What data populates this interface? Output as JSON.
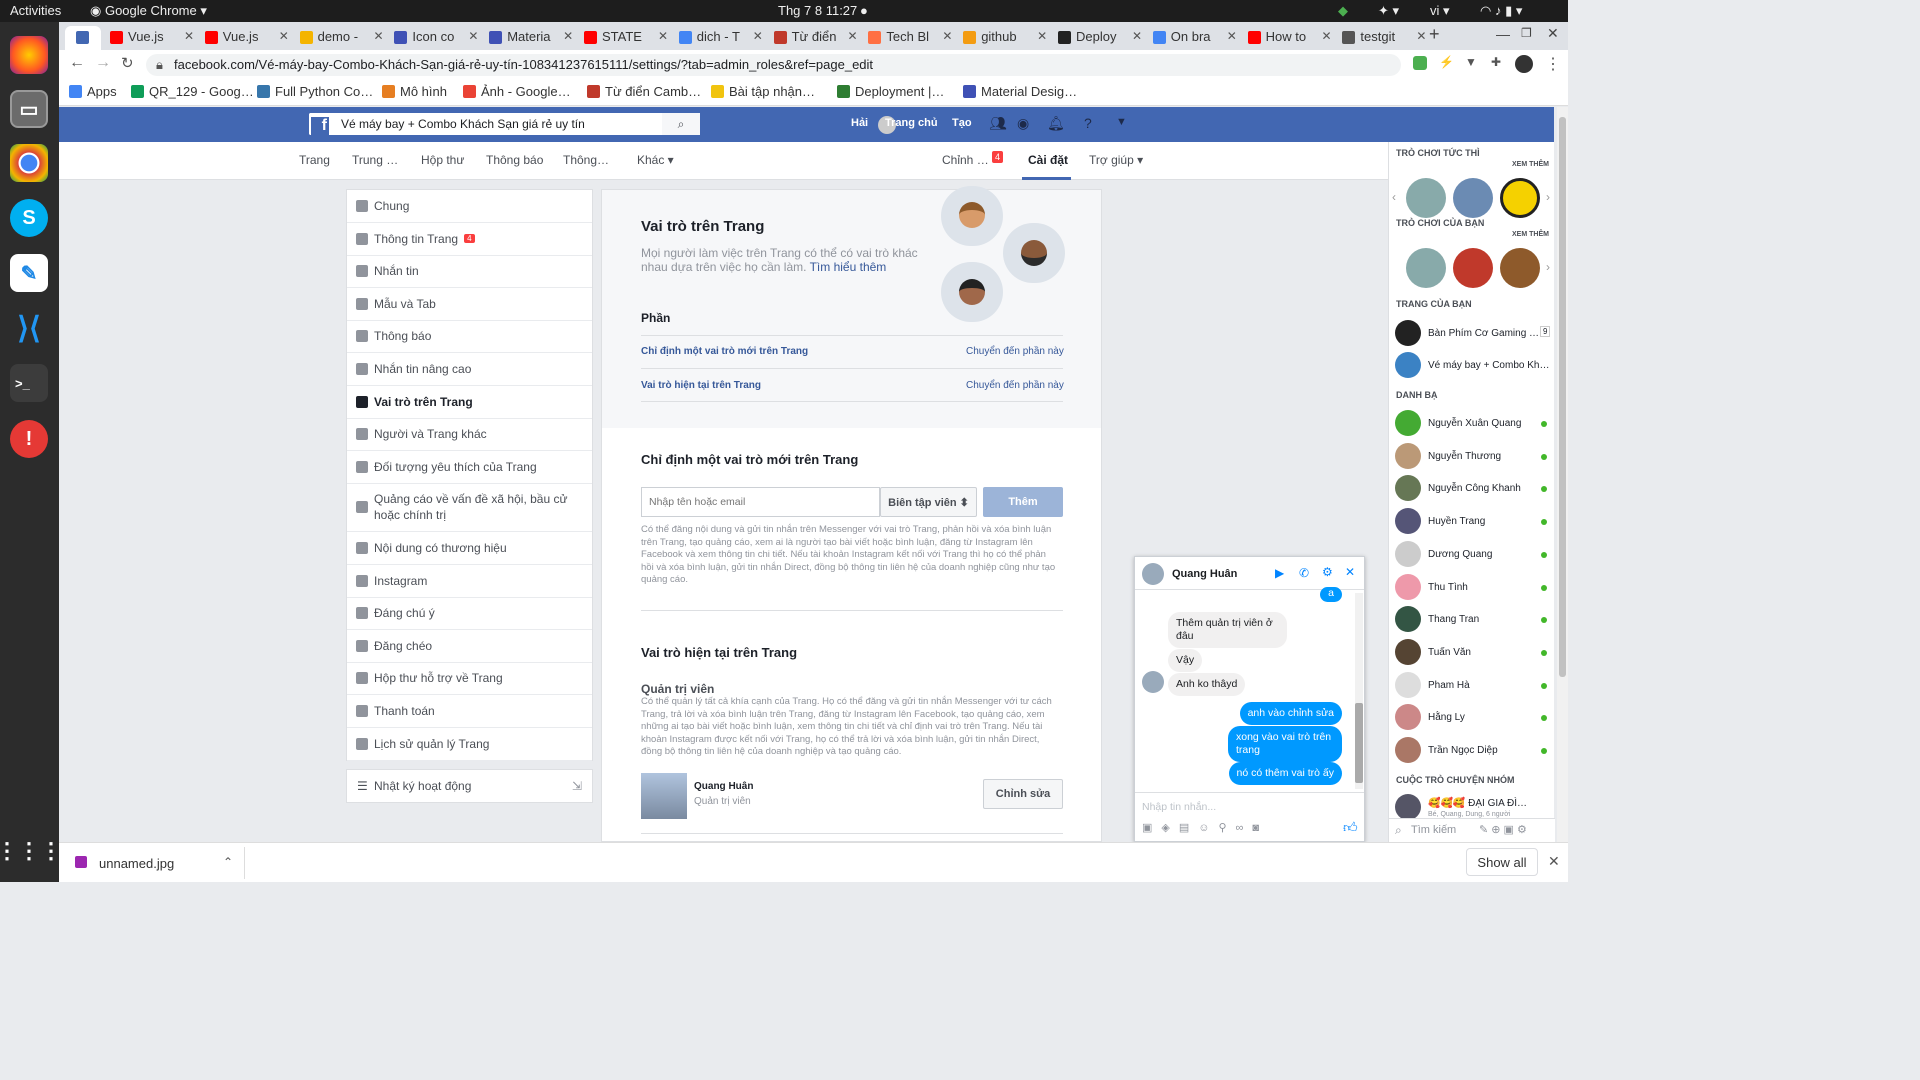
{
  "system_bar": {
    "activities": "Activities",
    "app": "Google Chrome",
    "clock": "Thg 7 8  11:27",
    "lang": "vi"
  },
  "tabs": [
    {
      "label": "Vue.js",
      "color": "#ff0000"
    },
    {
      "label": "Vue.js",
      "color": "#ff0000"
    },
    {
      "label": "demo -",
      "color": "#f4b400"
    },
    {
      "label": "Icon co",
      "color": "#3f51b5"
    },
    {
      "label": "Materia",
      "color": "#3f51b5"
    },
    {
      "label": "STATE",
      "color": "#ff0000"
    },
    {
      "label": "dich - T",
      "color": "#4285f4"
    },
    {
      "label": "Từ điển",
      "color": "#c0392b"
    },
    {
      "label": "Tech Bl",
      "color": "#ff7043"
    },
    {
      "label": "github",
      "color": "#f39c12"
    },
    {
      "label": "Deploy",
      "color": "#222222"
    },
    {
      "label": "On bra",
      "color": "#4285f4"
    },
    {
      "label": "How to",
      "color": "#ff0000"
    },
    {
      "label": "testgit",
      "color": "#555555"
    }
  ],
  "address": {
    "url": "facebook.com/Vé-máy-bay-Combo-Khách-Sạn-giá-rẻ-uy-tín-108341237615111/settings/?tab=admin_roles&ref=page_edit"
  },
  "bookmarks": [
    {
      "label": "Apps",
      "color": "#4285f4"
    },
    {
      "label": "QR_129 - Goog…",
      "color": "#0f9d58"
    },
    {
      "label": "Full Python Co…",
      "color": "#3776ab"
    },
    {
      "label": "Mô hình",
      "color": "#e67e22"
    },
    {
      "label": "Ảnh - Google…",
      "color": "#ea4335"
    },
    {
      "label": "Từ điển Camb…",
      "color": "#c0392b"
    },
    {
      "label": "Bài tập nhận…",
      "color": "#f1c40f"
    },
    {
      "label": "Deployment |…",
      "color": "#2e7d32"
    },
    {
      "label": "Material Desig…",
      "color": "#3f51b5"
    }
  ],
  "fb_header": {
    "search_value": "Vé máy bay + Combo Khách Sạn giá rẻ uy tín",
    "user": "Hải",
    "home": "Trang chủ",
    "create": "Tạo"
  },
  "page_nav": {
    "left": [
      "Trang",
      "Trung …",
      "Hộp thư",
      "Thông báo",
      "Thông…",
      "Khác ▾"
    ],
    "edit": "Chỉnh …",
    "edit_badge": "4",
    "settings": "Cài đặt",
    "help": "Trợ giúp ▾"
  },
  "settings_menu": [
    {
      "label": "Chung"
    },
    {
      "label": "Thông tin Trang",
      "badge": "4"
    },
    {
      "label": "Nhắn tin"
    },
    {
      "label": "Mẫu và Tab"
    },
    {
      "label": "Thông báo"
    },
    {
      "label": "Nhắn tin nâng cao"
    },
    {
      "label": "Vai trò trên Trang",
      "active": true
    },
    {
      "label": "Người và Trang khác"
    },
    {
      "label": "Đối tượng yêu thích của Trang"
    },
    {
      "label": "Quảng cáo về vấn đề xã hội, bầu cử hoặc chính trị"
    },
    {
      "label": "Nội dung có thương hiệu"
    },
    {
      "label": "Instagram"
    },
    {
      "label": "Đáng chú ý"
    },
    {
      "label": "Đăng chéo"
    },
    {
      "label": "Hộp thư hỗ trợ về Trang"
    },
    {
      "label": "Thanh toán"
    },
    {
      "label": "Lịch sử quản lý Trang"
    }
  ],
  "activity_log": "Nhật ký hoạt động",
  "roles": {
    "title": "Vai trò trên Trang",
    "desc": "Mọi người làm việc trên Trang có thể có vai trò khác nhau dựa trên việc họ cần làm.",
    "learn_more": "Tìm hiểu thêm",
    "section_label": "Phần",
    "section_rows": [
      {
        "name": "Chỉ định một vai trò mới trên Trang",
        "action": "Chuyển đến phần này"
      },
      {
        "name": "Vai trò hiện tại trên Trang",
        "action": "Chuyển đến phần này"
      }
    ],
    "assign_title": "Chỉ định một vai trò mới trên Trang",
    "assign_placeholder": "Nhập tên hoặc email",
    "assign_role": "Biên tập viên ⬍",
    "assign_button": "Thêm",
    "assign_desc": "Có thể đăng nội dung và gửi tin nhắn trên Messenger với vai trò Trang, phản hồi và xóa bình luận trên Trang, tạo quảng cáo, xem ai là người tạo bài viết hoặc bình luận, đăng từ Instagram lên Facebook và xem thông tin chi tiết. Nếu tài khoản Instagram kết nối với Trang thì họ có thể phản hồi và xóa bình luận, gửi tin nhắn Direct, đồng bộ thông tin liên hệ của doanh nghiệp cũng như tạo quảng cáo.",
    "current_title": "Vai trò hiện tại trên Trang",
    "admin_label": "Quản trị viên",
    "admin_desc": "Có thể quản lý tất cả khía cạnh của Trang. Họ có thể đăng và gửi tin nhắn Messenger với tư cách Trang, trả lời và xóa bình luận trên Trang, đăng từ Instagram lên Facebook, tạo quảng cáo, xem những ai tạo bài viết hoặc bình luận, xem thông tin chi tiết và chỉ định vai trò trên Trang. Nếu tài khoản Instagram được kết nối với Trang, họ có thể trả lời và xóa bình luận, gửi tin nhắn Direct, đồng bộ thông tin liên hệ của doanh nghiệp và tạo quảng cáo.",
    "admin_name": "Quang Huân",
    "admin_role": "Quản trị viên",
    "edit_button": "Chỉnh sửa"
  },
  "sidebar": {
    "games_title": "TRÒ CHƠI TỨC THÌ",
    "see_more": "XEM THÊM",
    "your_games": "TRÒ CHƠI CỦA BẠN",
    "your_pages": "TRANG CỦA BẠN",
    "pages": [
      {
        "name": "Bàn Phím Cơ Gaming …",
        "count": "9"
      },
      {
        "name": "Vé máy bay + Combo Kh…"
      }
    ],
    "contacts_title": "DANH BẠ",
    "contacts": [
      "Nguyễn Xuân Quang",
      "Nguyễn Thương",
      "Nguyễn Công Khanh",
      "Huyền Trang",
      "Dương Quang",
      "Thu Tình",
      "Thang Tran",
      "Tuấn Văn",
      "Pham Hà",
      "Hằng Ly",
      "Trần Ngọc Diệp"
    ],
    "groups_title": "CUỘC TRÒ CHUYỆN NHÓM",
    "group_name": "🥰🥰🥰 ĐẠI GIA ĐÌ…",
    "group_sub": "Bé, Quang, Dung, 6 người",
    "search_placeholder": "Tìm kiếm"
  },
  "chat": {
    "name": "Quang Huân",
    "messages": [
      {
        "from": "out",
        "text": "a"
      },
      {
        "from": "in",
        "text": "Thêm quản trị viên ở đâu"
      },
      {
        "from": "in",
        "text": "Vậy"
      },
      {
        "from": "in",
        "text": "Anh ko thâyd"
      },
      {
        "from": "out",
        "text": "anh vào chỉnh sửa"
      },
      {
        "from": "out",
        "text": "xong vào vai trò trên trang"
      },
      {
        "from": "out",
        "text": "nó có thêm vai trò ấy"
      }
    ],
    "input_placeholder": "Nhập tin nhắn..."
  },
  "downloads": {
    "file": "unnamed.jpg",
    "show_all": "Show all"
  },
  "colors": {
    "fb_blue": "#4267b2",
    "link": "#365899",
    "button_disabled": "#9cb4d8",
    "online": "#42b72a",
    "badge": "#fa3e3e"
  }
}
